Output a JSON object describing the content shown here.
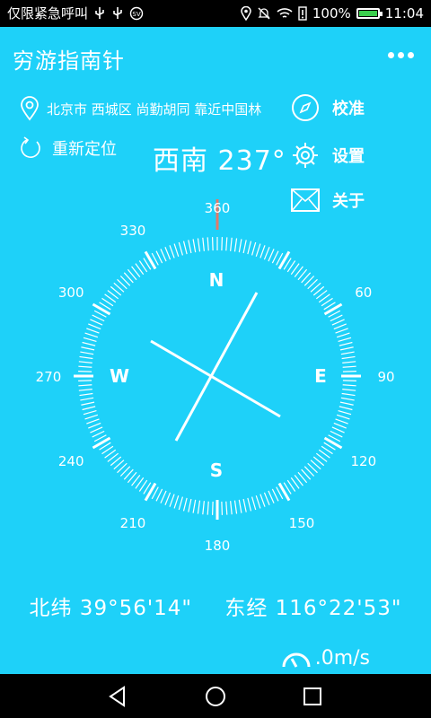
{
  "status_bar": {
    "carrier": "仅限紧急呼叫",
    "battery_percent": "100%",
    "time": "11:04"
  },
  "app": {
    "title": "穷游指南针",
    "location": "北京市 西城区 尚勤胡同 靠近中国林",
    "relocate_label": "重新定位",
    "heading": "西南 237°",
    "menu": {
      "calibrate": "校准",
      "settings": "设置",
      "about": "关于"
    },
    "compass": {
      "cardinals": {
        "n": "N",
        "e": "E",
        "s": "S",
        "w": "W"
      },
      "degree_labels": [
        "360",
        "330",
        "300",
        "270",
        "240",
        "210",
        "180",
        "150",
        "120",
        "90",
        "60"
      ]
    },
    "latitude": "北纬 39°56'14\"",
    "longitude": "东经 116°22'53\"",
    "speed": ".0m/s"
  },
  "colors": {
    "background": "#1ed1f9",
    "north_marker": "#e07a6a"
  }
}
